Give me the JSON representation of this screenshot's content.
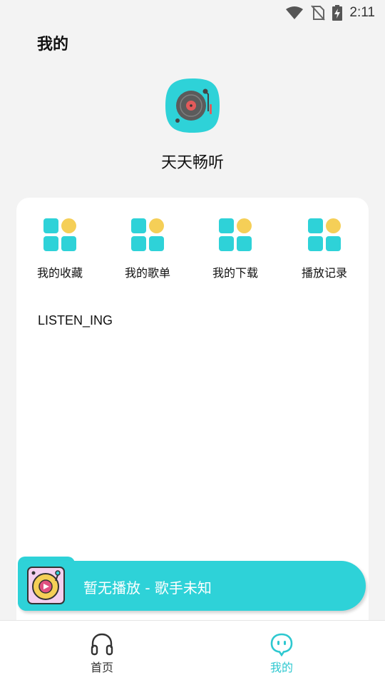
{
  "status_bar": {
    "time": "2:11",
    "icons": [
      "wifi-icon",
      "no-sim-icon",
      "battery-charging-icon"
    ]
  },
  "header": {
    "title": "我的"
  },
  "profile": {
    "app_name": "天天畅听",
    "logo_icon": "turntable-icon"
  },
  "quick_actions": [
    {
      "label": "我的收藏",
      "icon": "grid-apps-icon"
    },
    {
      "label": "我的歌单",
      "icon": "grid-apps-icon"
    },
    {
      "label": "我的下载",
      "icon": "grid-apps-icon"
    },
    {
      "label": "播放记录",
      "icon": "grid-apps-icon"
    }
  ],
  "section": {
    "label": "LISTEN_ING"
  },
  "player": {
    "text": "暂无播放 - 歌手未知",
    "art_icon": "record-player-icon"
  },
  "bottom_nav": {
    "items": [
      {
        "label": "首页",
        "icon": "headphones-icon",
        "active": false
      },
      {
        "label": "我的",
        "icon": "smiley-face-icon",
        "active": true
      }
    ]
  },
  "colors": {
    "accent": "#2ed2d8",
    "tile_teal": "#2ed2d8",
    "tile_yellow": "#f5cf57",
    "background": "#f3f3f3",
    "card": "#ffffff"
  }
}
